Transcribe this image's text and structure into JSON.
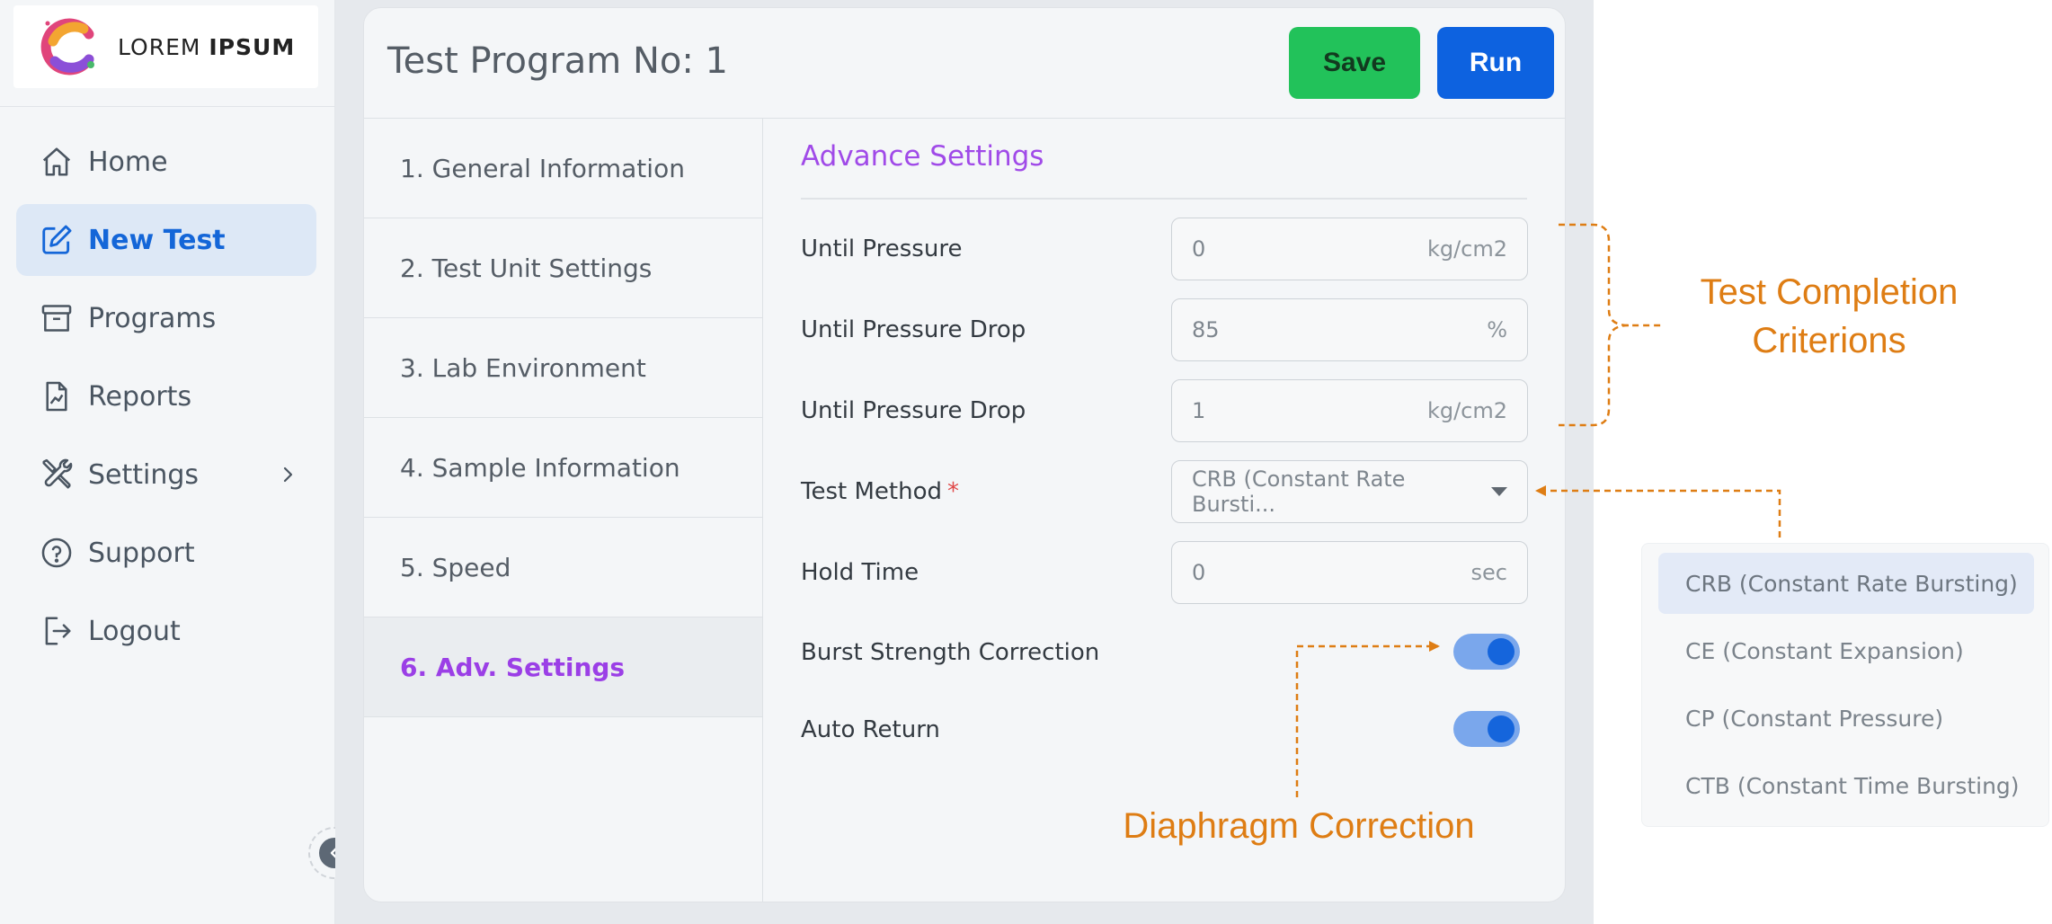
{
  "logo": {
    "text_light": "LOREM",
    "text_bold": "IPSUM"
  },
  "sidebar": {
    "items": [
      {
        "label": "Home",
        "icon": "home-icon"
      },
      {
        "label": "New Test",
        "icon": "edit-icon",
        "active": true
      },
      {
        "label": "Programs",
        "icon": "archive-icon"
      },
      {
        "label": "Reports",
        "icon": "report-icon"
      },
      {
        "label": "Settings",
        "icon": "tools-icon"
      },
      {
        "label": "Support",
        "icon": "help-icon"
      },
      {
        "label": "Logout",
        "icon": "logout-icon"
      }
    ]
  },
  "header": {
    "title": "Test Program No: 1",
    "save_label": "Save",
    "run_label": "Run"
  },
  "steps": [
    {
      "label": "1. General Information"
    },
    {
      "label": "2. Test Unit Settings"
    },
    {
      "label": "3. Lab Environment"
    },
    {
      "label": "4. Sample Information"
    },
    {
      "label": "5. Speed"
    },
    {
      "label": "6. Adv. Settings",
      "active": true
    }
  ],
  "form": {
    "section_title": "Advance Settings",
    "until_pressure": {
      "label": "Until Pressure",
      "value": "0",
      "unit": "kg/cm2"
    },
    "until_pressure_drop_pct": {
      "label": "Until Pressure Drop",
      "value": "85",
      "unit": "%"
    },
    "until_pressure_drop_abs": {
      "label": "Until Pressure Drop",
      "value": "1",
      "unit": "kg/cm2"
    },
    "test_method": {
      "label": "Test Method",
      "required_mark": "*",
      "value": "CRB (Constant Rate Bursti..."
    },
    "hold_time": {
      "label": "Hold Time",
      "value": "0",
      "unit": "sec"
    },
    "burst_strength_correction": {
      "label": "Burst Strength Correction",
      "on": true
    },
    "auto_return": {
      "label": "Auto Return",
      "on": true
    }
  },
  "dropdown_options": [
    {
      "label": "CRB (Constant Rate Bursting)",
      "selected": true
    },
    {
      "label": "CE (Constant Expansion)"
    },
    {
      "label": "CP (Constant Pressure)"
    },
    {
      "label": "CTB (Constant Time Bursting)"
    }
  ],
  "annotations": {
    "test_completion_line1": "Test Completion",
    "test_completion_line2": "Criterions",
    "diaphragm_correction": "Diaphragm Correction"
  },
  "colors": {
    "primary": "#0d62e0",
    "success": "#22c25a",
    "accent_purple": "#a04ae8",
    "annotation_orange": "#de7d14"
  }
}
